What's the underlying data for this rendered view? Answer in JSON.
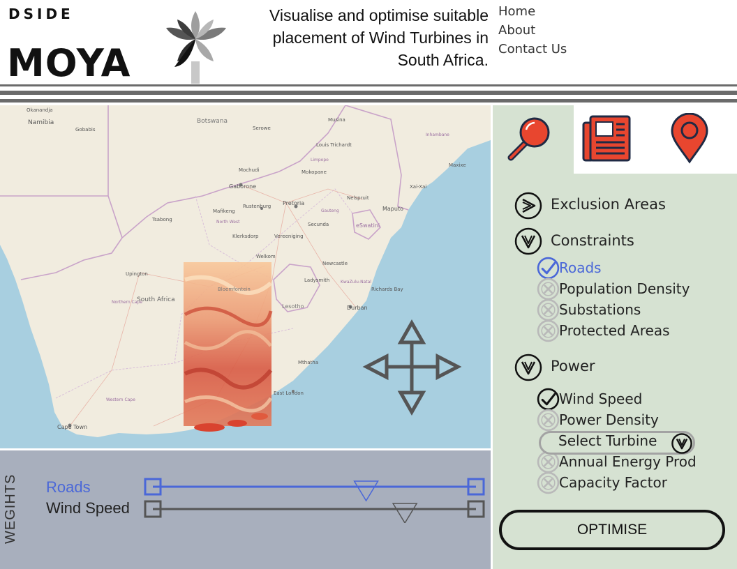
{
  "header": {
    "brand_small": "DSIDE",
    "brand_big": "MOYA",
    "tagline_lines": [
      "Visualise and optimise suitable",
      "placement of Wind Turbines in",
      "South Africa."
    ],
    "nav": [
      "Home",
      "About",
      "Contact Us"
    ]
  },
  "map": {
    "labels": {
      "namibia": "Namibia",
      "gobabis": "Gobabis",
      "botswana": "Botswana",
      "serowe": "Serowe",
      "musina": "Musina",
      "louis_trichardt": "Louis Trichardt",
      "mochudi": "Mochudi",
      "mokopane": "Mokopane",
      "gaborone": "Gaborone",
      "xai_xai": "Xai-Xai",
      "maputo": "Maputo",
      "pretoria": "Pretoria",
      "rustenburg": "Rustenburg",
      "mafikeng": "Mafikeng",
      "nelspruit": "Nelspruit",
      "tsabong": "Tsabong",
      "north_west": "North West",
      "secunda": "Secunda",
      "eswatini": "eSwatini",
      "klerksdorp": "Klerksdorp",
      "vereeniging": "Vereeniging",
      "welkom": "Welkom",
      "newcastle": "Newcastle",
      "upington": "Upington",
      "bloemfontein": "Bloemfontein",
      "ladysmith": "Ladysmith",
      "kwazulu_natal": "KwaZulu-Natal",
      "richards_bay": "Richards Bay",
      "south_africa": "South Africa",
      "lesotho": "Lesotho",
      "durban": "Durban",
      "northern_cape": "Northern Cape",
      "mthatha": "Mthatha",
      "western_cape": "Western Cape",
      "east_london": "East London",
      "cape_town": "Cape Town",
      "limpopo": "Limpopo",
      "gauteng": "Gauteng",
      "okanandja": "Okanandja",
      "maxixe": "Maxixe",
      "inhambane": "Inhambane"
    }
  },
  "weights": {
    "title": "WEGIHTS",
    "sliders": [
      {
        "label": "Roads",
        "value": 0.66,
        "color": "#4a67d8"
      },
      {
        "label": "Wind Speed",
        "value": 0.78,
        "color": "#555555"
      }
    ]
  },
  "panel": {
    "tabs": [
      {
        "icon": "search-icon"
      },
      {
        "icon": "newspaper-icon"
      },
      {
        "icon": "location-pin-icon"
      }
    ],
    "sections": {
      "exclusion": "Exclusion Areas",
      "constraints": "Constraints",
      "power": "Power"
    },
    "constraint_items": [
      {
        "label": "Roads",
        "checked": true
      },
      {
        "label": "Population Density",
        "checked": false
      },
      {
        "label": "Substations",
        "checked": false
      },
      {
        "label": "Protected Areas",
        "checked": false
      }
    ],
    "power_items": [
      {
        "label": "Wind Speed",
        "checked": true
      },
      {
        "label": "Power Density",
        "checked": false
      },
      {
        "label": "Annual Energy Prod",
        "checked": false
      },
      {
        "label": "Capacity Factor",
        "checked": false
      }
    ],
    "turbine_select": "Select Turbine",
    "optimise_label": "OPTIMISE"
  },
  "colors": {
    "accent_blue": "#4a67d8",
    "tab_red": "#e8462f",
    "panel_bg": "#d6e2d2",
    "weights_bg": "#a8afbd",
    "ocean": "#a8cfe0"
  }
}
